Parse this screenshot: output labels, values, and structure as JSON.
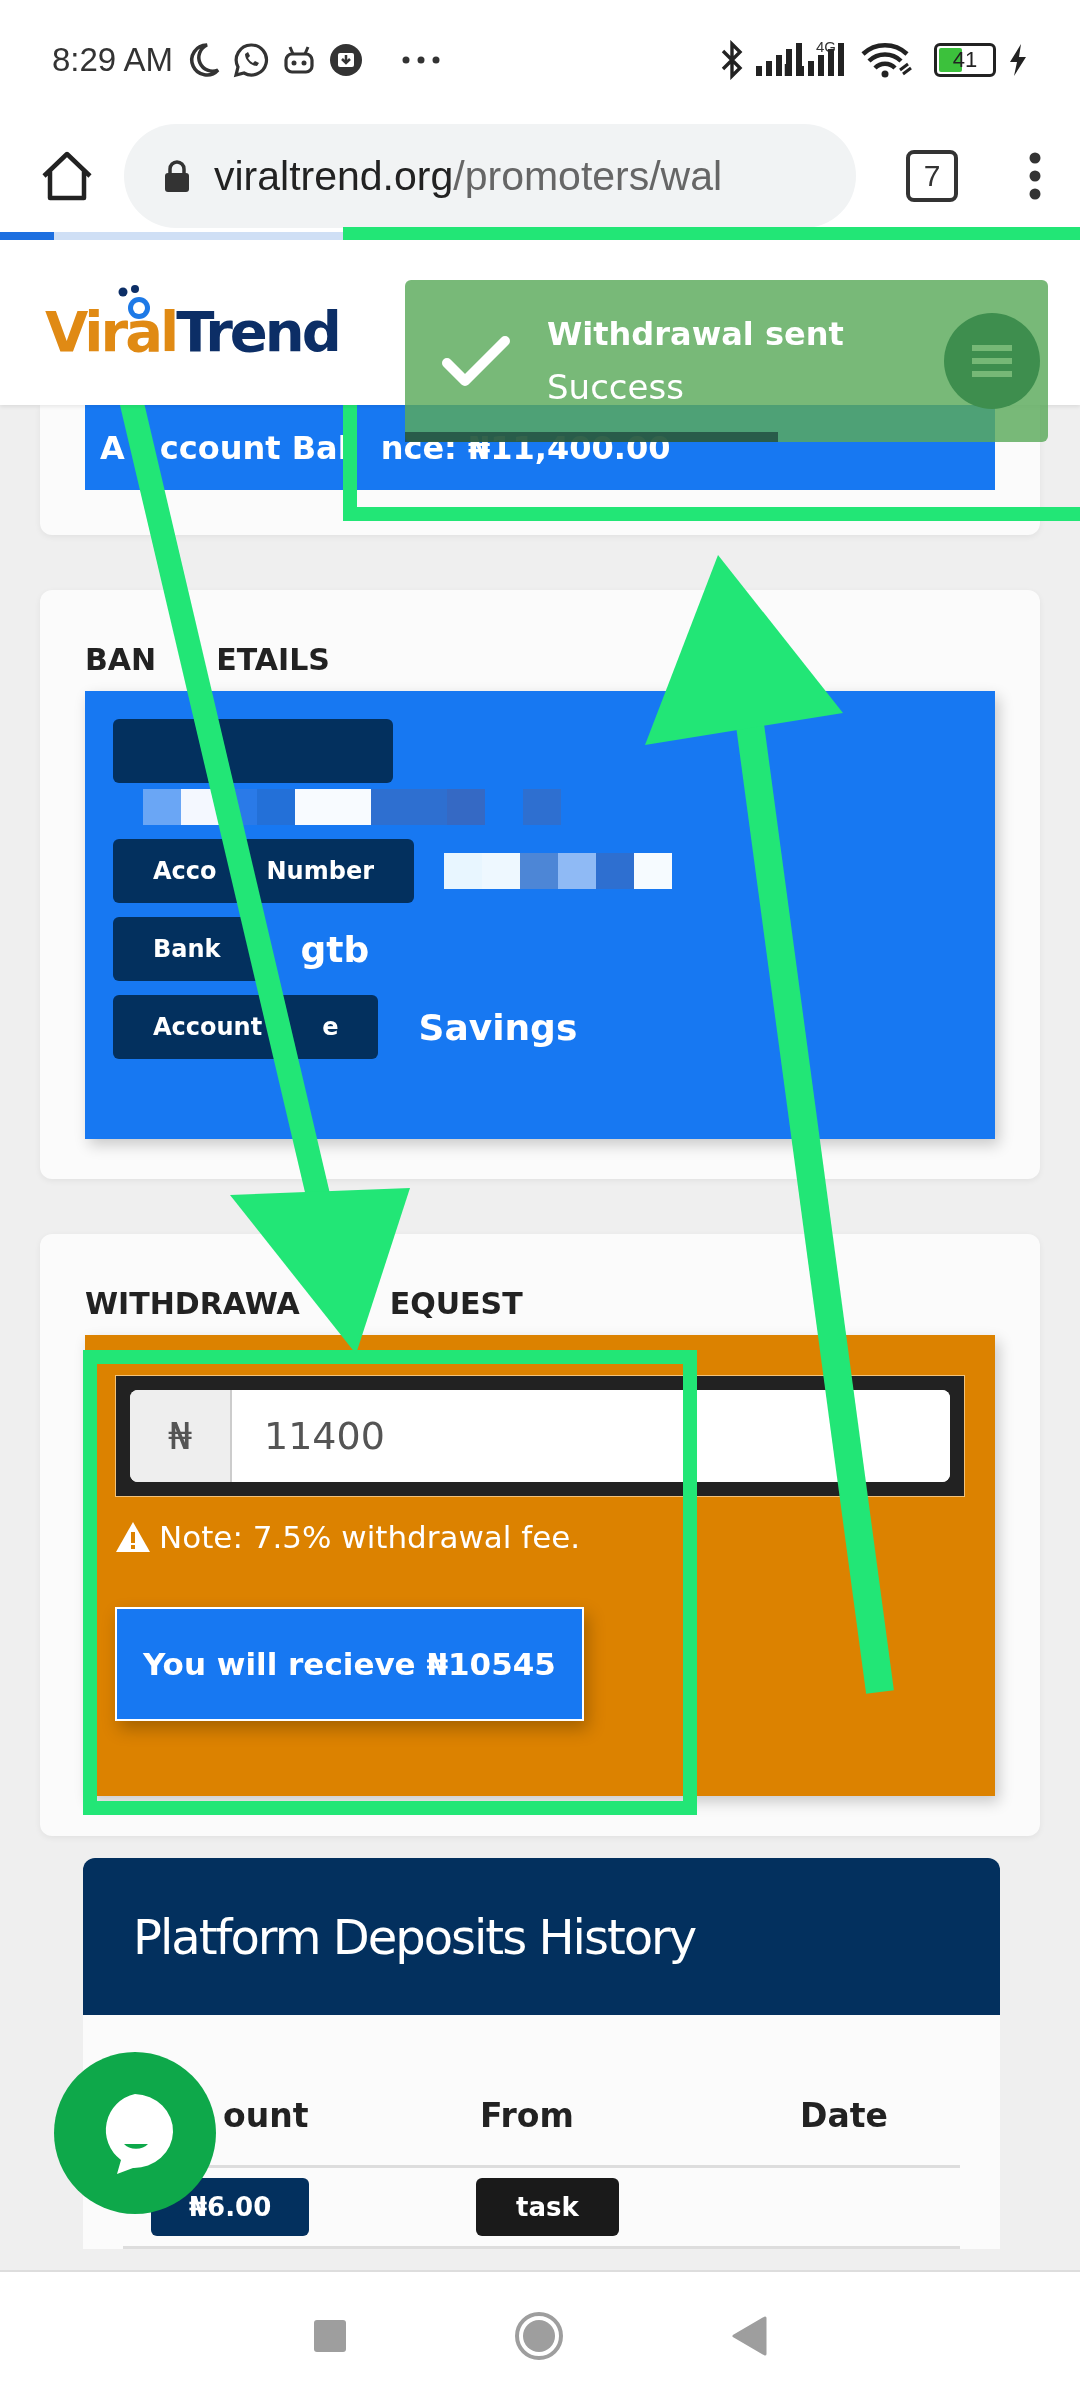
{
  "status_bar": {
    "time": "8:29 AM",
    "network_type": "4G",
    "battery": "41"
  },
  "browser": {
    "url_host": "viraltrend.org",
    "url_path": "/promoters/wal",
    "tab_count": "7",
    "page_load": {
      "level": 0.05
    }
  },
  "site": {
    "logo": {
      "accent": "Viral",
      "main": "Trend"
    }
  },
  "toast": {
    "title": "Withdrawal sent",
    "message": "Success",
    "level": 0.58
  },
  "balance": {
    "parts": [
      "A",
      "ccount Bal",
      "nce: ₦11,400.00"
    ]
  },
  "bank_details": {
    "title_parts": [
      "BAN",
      "ETAILS"
    ],
    "rows": [
      {
        "kind": "redacted"
      },
      {
        "kind": "masked",
        "label_parts": [
          "Acco",
          "Number"
        ]
      },
      {
        "kind": "text",
        "label_parts": [
          "Bank"
        ],
        "value": "gtb"
      },
      {
        "kind": "text",
        "label_parts": [
          "Account",
          "e"
        ],
        "value": "Savings"
      }
    ]
  },
  "withdrawal": {
    "title_parts": [
      "WITHDRAWA",
      "EQUEST"
    ],
    "currency": "₦",
    "amount": "11400",
    "note": "Note: 7.5% withdrawal fee.",
    "button": "You will recieve ₦10545"
  },
  "deposits": {
    "title": "Platform Deposits History",
    "columns": [
      "ount",
      "From",
      "Date"
    ],
    "rows": [
      {
        "amount": "₦6.00",
        "from": "task"
      }
    ]
  }
}
